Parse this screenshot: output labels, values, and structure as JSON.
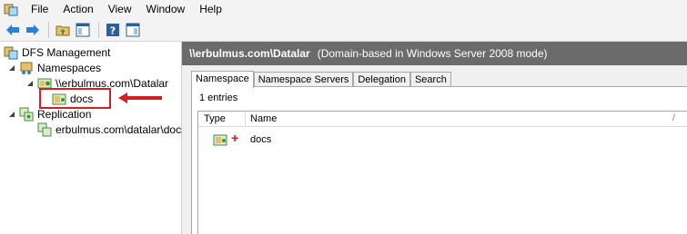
{
  "menu": [
    "File",
    "Action",
    "View",
    "Window",
    "Help"
  ],
  "toolbar": {
    "icons": [
      "back-arrow-icon",
      "forward-arrow-icon",
      "up-folder-icon",
      "show-hide-tree-icon",
      "help-icon",
      "show-hide-action-pane-icon"
    ]
  },
  "tree": {
    "root": "DFS Management",
    "namespaces": "Namespaces",
    "namespace_item": "\\\\erbulmus.com\\Datalar",
    "folder": "docs",
    "replication": "Replication",
    "replication_group": "erbulmus.com\\datalar\\docs"
  },
  "detail": {
    "path": "\\\\erbulmus.com\\Datalar",
    "mode": "(Domain-based in Windows Server 2008 mode)",
    "tabs": [
      "Namespace",
      "Namespace Servers",
      "Delegation",
      "Search"
    ],
    "entries": "1 entries",
    "columns": {
      "type": "Type",
      "name": "Name"
    },
    "rows": [
      {
        "name": "docs"
      }
    ]
  },
  "colors": {
    "annotation": "#d42020",
    "title_bar": "#6b6b6b"
  }
}
